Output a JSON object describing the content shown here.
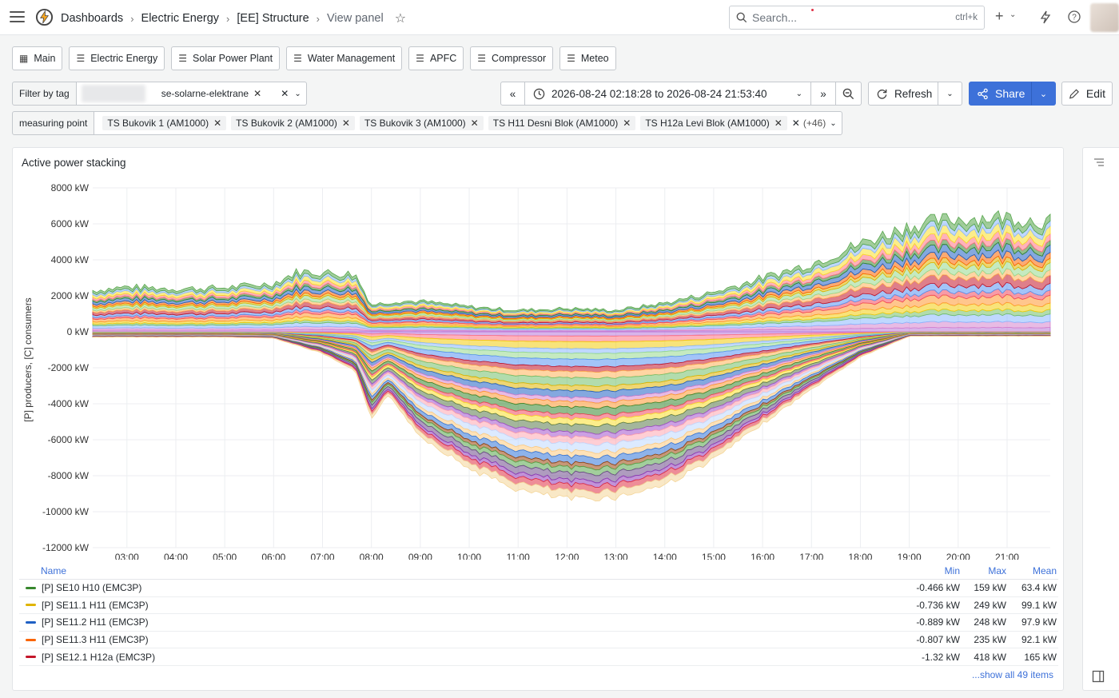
{
  "topbar": {
    "breadcrumbs": [
      "Dashboards",
      "Electric Energy",
      "[EE] Structure",
      "View panel"
    ],
    "search_placeholder": "Search...",
    "search_shortcut": "ctrl+k",
    "add_label": "+"
  },
  "links": [
    {
      "label": "Main",
      "icon": "grid-icon"
    },
    {
      "label": "Electric Energy",
      "icon": "bars-icon"
    },
    {
      "label": "Solar Power Plant",
      "icon": "bars-icon"
    },
    {
      "label": "Water Management",
      "icon": "bars-icon"
    },
    {
      "label": "APFC",
      "icon": "bars-icon"
    },
    {
      "label": "Compressor",
      "icon": "bars-icon"
    },
    {
      "label": "Meteo",
      "icon": "bars-icon"
    }
  ],
  "filter_tag": {
    "label": "Filter by tag",
    "value": "se-solarne-elektrane"
  },
  "time": {
    "range": "2026-08-24 02:18:28 to 2026-08-24 21:53:40",
    "refresh_label": "Refresh",
    "share_label": "Share",
    "edit_label": "Edit"
  },
  "measuring_point": {
    "label": "measuring point",
    "chips": [
      "TS Bukovik 1 (AM1000)",
      "TS Bukovik 2 (AM1000)",
      "TS Bukovik 3 (AM1000)",
      "TS H11 Desni Blok (AM1000)",
      "TS H12a Levi Blok (AM1000)"
    ],
    "more": "(+46)"
  },
  "panel": {
    "title": "Active power stacking",
    "ylabel": "[P] producers, [C] consumers"
  },
  "chart_data": {
    "type": "area",
    "stacked": true,
    "y_unit": "kW",
    "ylim": [
      -12000,
      8000
    ],
    "yticks": [
      "8000 kW",
      "6000 kW",
      "4000 kW",
      "2000 kW",
      "0 kW",
      "-2000 kW",
      "-4000 kW",
      "-6000 kW",
      "-8000 kW",
      "-10000 kW",
      "-12000 kW"
    ],
    "xticks": [
      "03:00",
      "04:00",
      "05:00",
      "06:00",
      "07:00",
      "08:00",
      "09:00",
      "10:00",
      "11:00",
      "12:00",
      "13:00",
      "14:00",
      "15:00",
      "16:00",
      "17:00",
      "18:00",
      "19:00",
      "20:00",
      "21:00"
    ],
    "total_producers_kW": [
      [
        "02:18",
        2300
      ],
      [
        "03:00",
        2500
      ],
      [
        "04:00",
        2400
      ],
      [
        "05:00",
        2450
      ],
      [
        "06:00",
        2700
      ],
      [
        "06:30",
        3350
      ],
      [
        "07:00",
        3300
      ],
      [
        "07:40",
        3200
      ],
      [
        "08:00",
        1500
      ],
      [
        "08:30",
        1700
      ],
      [
        "09:00",
        1700
      ],
      [
        "10:00",
        1400
      ],
      [
        "11:00",
        1200
      ],
      [
        "12:00",
        1300
      ],
      [
        "13:00",
        1200
      ],
      [
        "14:00",
        1600
      ],
      [
        "15:00",
        2200
      ],
      [
        "16:00",
        3000
      ],
      [
        "17:00",
        3800
      ],
      [
        "18:00",
        4900
      ],
      [
        "19:00",
        5900
      ],
      [
        "20:00",
        6300
      ],
      [
        "21:00",
        6400
      ],
      [
        "21:53",
        6100
      ]
    ],
    "total_consumers_kW": [
      [
        "02:18",
        -300
      ],
      [
        "05:00",
        -300
      ],
      [
        "06:00",
        -350
      ],
      [
        "07:00",
        -1200
      ],
      [
        "07:40",
        -2200
      ],
      [
        "08:00",
        -4800
      ],
      [
        "08:20",
        -3500
      ],
      [
        "09:00",
        -5800
      ],
      [
        "10:00",
        -7600
      ],
      [
        "11:00",
        -8800
      ],
      [
        "12:00",
        -9300
      ],
      [
        "13:00",
        -9200
      ],
      [
        "14:00",
        -8500
      ],
      [
        "15:00",
        -7100
      ],
      [
        "16:00",
        -5100
      ],
      [
        "17:00",
        -3200
      ],
      [
        "18:00",
        -1400
      ],
      [
        "19:00",
        -250
      ],
      [
        "21:53",
        -250
      ]
    ]
  },
  "legend": {
    "headers": {
      "name": "Name",
      "min": "Min",
      "max": "Max",
      "mean": "Mean"
    },
    "rows": [
      {
        "name": "[P] SE10 H10 (EMC3P)",
        "color": "#37872d",
        "min": "-0.466 kW",
        "max": "159 kW",
        "mean": "63.4 kW"
      },
      {
        "name": "[P] SE11.1 H11 (EMC3P)",
        "color": "#e0b400",
        "min": "-0.736 kW",
        "max": "249 kW",
        "mean": "99.1 kW"
      },
      {
        "name": "[P] SE11.2 H11 (EMC3P)",
        "color": "#1f60c4",
        "min": "-0.889 kW",
        "max": "248 kW",
        "mean": "97.9 kW"
      },
      {
        "name": "[P] SE11.3 H11 (EMC3P)",
        "color": "#fa6400",
        "min": "-0.807 kW",
        "max": "235 kW",
        "mean": "92.1 kW"
      },
      {
        "name": "[P] SE12.1 H12a (EMC3P)",
        "color": "#c4162a",
        "min": "-1.32 kW",
        "max": "418 kW",
        "mean": "165 kW"
      }
    ],
    "show_all": "...show all 49 items"
  }
}
